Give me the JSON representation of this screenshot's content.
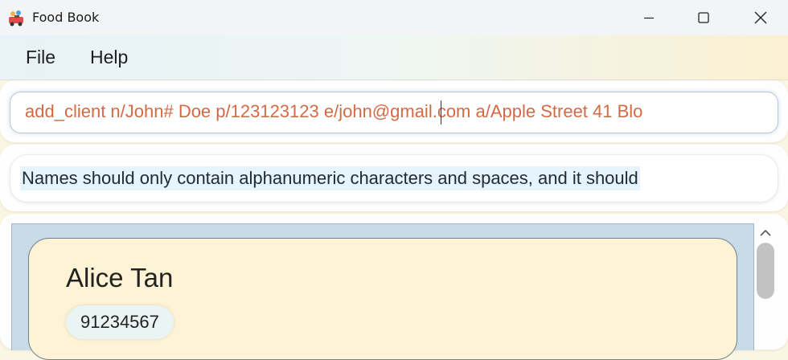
{
  "window": {
    "title": "Food Book",
    "controls": {
      "minimize": "minimize",
      "maximize": "maximize",
      "close": "close"
    }
  },
  "menu": {
    "file": "File",
    "help": "Help"
  },
  "command": {
    "value": "add_client n/John# Doe p/123123123 e/john@gmail.com a/Apple Street 41 Blo",
    "color": "#d46a45"
  },
  "result": {
    "text": "Names should only contain alphanumeric characters and spaces, and it should"
  },
  "clients": [
    {
      "name": "Alice Tan",
      "phone": "91234567"
    }
  ],
  "colors": {
    "card_bg": "#fff3d5",
    "list_bg": "#c9dbe6",
    "phone_chip": "#e9f4f3"
  },
  "icons": {
    "app": "food-book-app-icon",
    "minimize": "minimize-icon",
    "maximize": "maximize-icon",
    "close": "close-icon",
    "scroll_up": "chevron-up-icon"
  }
}
